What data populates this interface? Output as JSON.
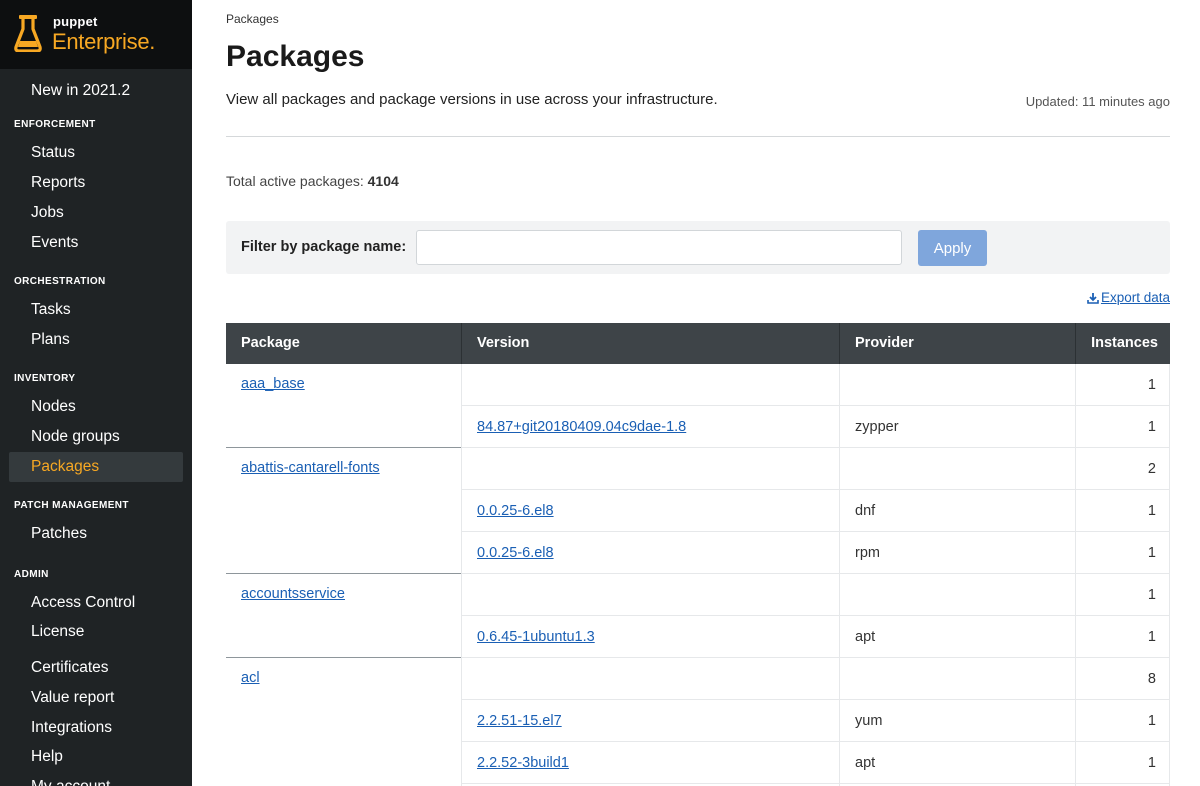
{
  "brand": {
    "small": "puppet",
    "big": "Enterprise",
    "dot": "."
  },
  "sidebar": {
    "whats_new": "New in 2021.2",
    "sections": [
      {
        "title": "ENFORCEMENT",
        "items": [
          "Status",
          "Reports",
          "Jobs",
          "Events"
        ]
      },
      {
        "title": "ORCHESTRATION",
        "items": [
          "Tasks",
          "Plans"
        ]
      },
      {
        "title": "INVENTORY",
        "items": [
          "Nodes",
          "Node groups",
          "Packages"
        ]
      },
      {
        "title": "PATCH MANAGEMENT",
        "items": [
          "Patches"
        ]
      },
      {
        "title": "ADMIN",
        "items": [
          "Access Control",
          "License",
          "Certificates",
          "Value report",
          "Integrations",
          "Help",
          "My account"
        ]
      }
    ],
    "active_item": "Packages"
  },
  "page": {
    "breadcrumb": "Packages",
    "title": "Packages",
    "description": "View all packages and package versions in use across your infrastructure.",
    "updated": "Updated: 11 minutes ago",
    "total_label": "Total active packages:",
    "total_value": "4104"
  },
  "filter": {
    "label": "Filter by package name:",
    "value": "",
    "placeholder": "",
    "apply_label": "Apply"
  },
  "export_label": "Export data",
  "table": {
    "headers": [
      "Package",
      "Version",
      "Provider",
      "Instances"
    ],
    "rows": [
      {
        "package": "aaa_base",
        "version": "",
        "provider": "",
        "instances": "1"
      },
      {
        "package": "",
        "version": "84.87+git20180409.04c9dae-1.8",
        "provider": "zypper",
        "instances": "1"
      },
      {
        "package": "abattis-cantarell-fonts",
        "version": "",
        "provider": "",
        "instances": "2"
      },
      {
        "package": "",
        "version": "0.0.25-6.el8",
        "provider": "dnf",
        "instances": "1"
      },
      {
        "package": "",
        "version": "0.0.25-6.el8",
        "provider": "rpm",
        "instances": "1"
      },
      {
        "package": "accountsservice",
        "version": "",
        "provider": "",
        "instances": "1"
      },
      {
        "package": "",
        "version": "0.6.45-1ubuntu1.3",
        "provider": "apt",
        "instances": "1"
      },
      {
        "package": "acl",
        "version": "",
        "provider": "",
        "instances": "8"
      },
      {
        "package": "",
        "version": "2.2.51-15.el7",
        "provider": "yum",
        "instances": "1"
      },
      {
        "package": "",
        "version": "2.2.52-3build1",
        "provider": "apt",
        "instances": "1"
      }
    ]
  },
  "colors": {
    "accent": "#f7a823",
    "sidebar_bg": "#1f2325",
    "link": "#1a5fb4",
    "apply_bg": "#7fa6dc",
    "table_header_bg": "#3e4448"
  }
}
